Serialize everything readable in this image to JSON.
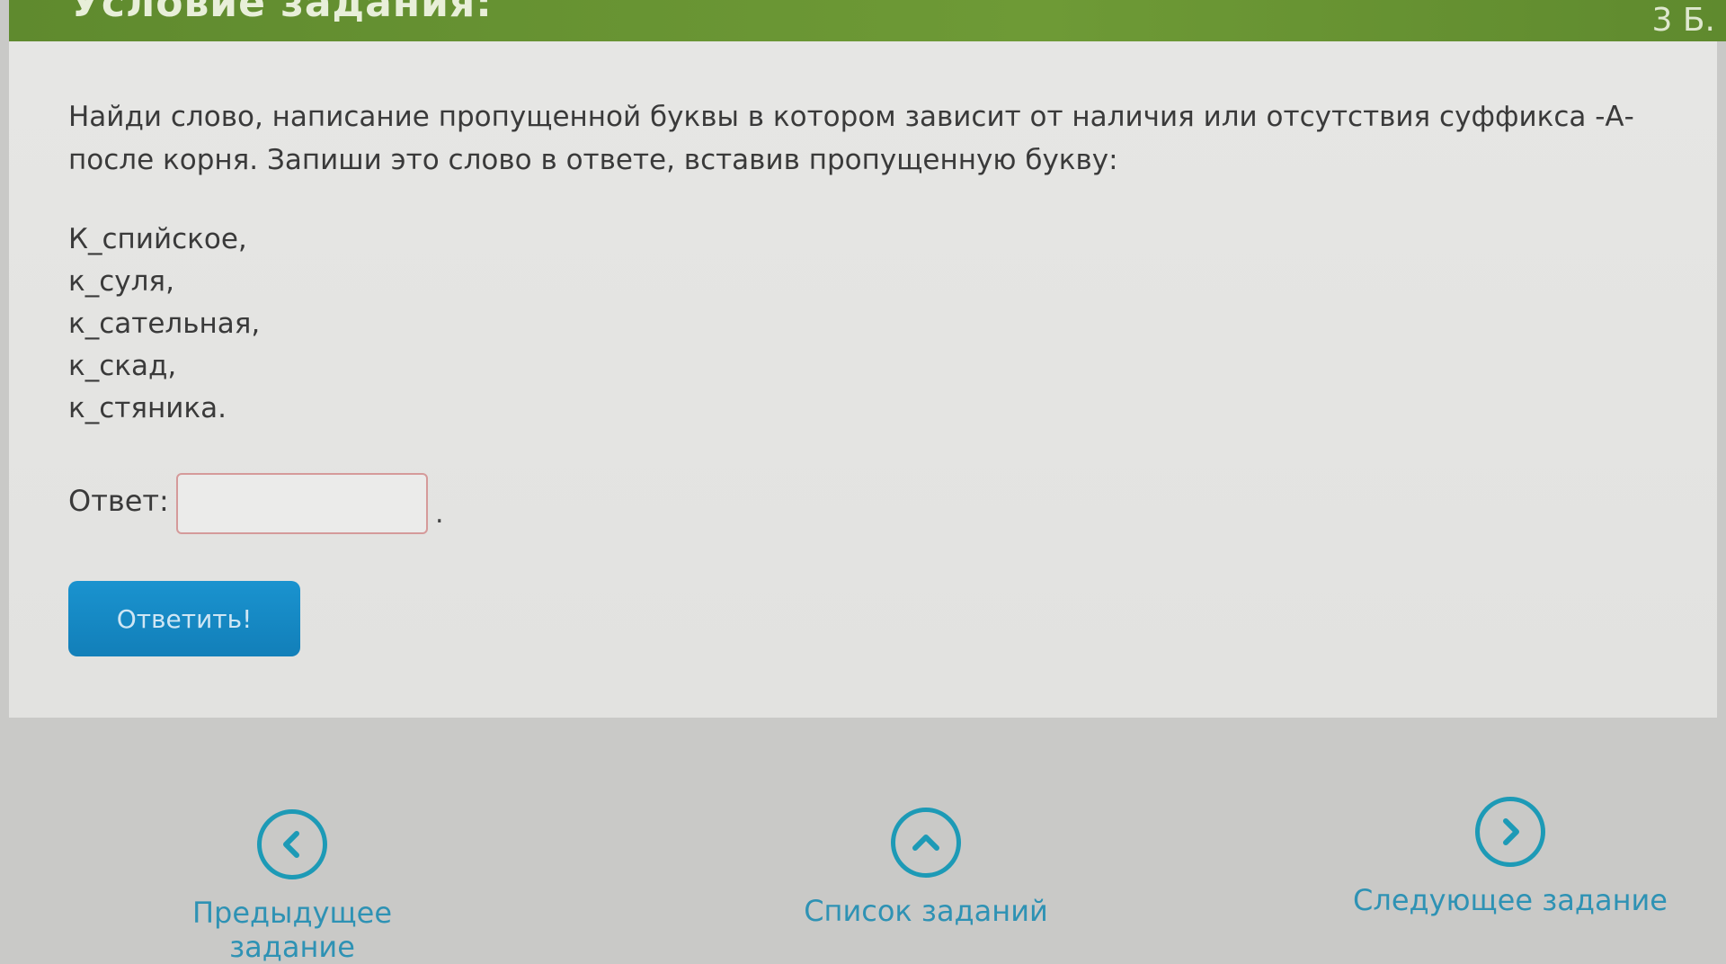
{
  "header": {
    "title": "Условие задания:",
    "points": "3 Б."
  },
  "question": {
    "text": "Найди слово, написание пропущенной буквы в котором зависит от наличия или отсутствия суффикса -А- после корня. Запиши это слово в ответе, вставив пропущенную букву:"
  },
  "words": [
    "К_спийское,",
    "к_суля,",
    "к_сательная,",
    "к_скад,",
    "к_стяника."
  ],
  "answer": {
    "label": "Ответ:",
    "value": "",
    "placeholder": "",
    "suffix": "."
  },
  "submit": {
    "label": "Ответить!"
  },
  "nav": {
    "prev_label": "Предыдущее задание",
    "list_label": "Список заданий",
    "next_label": "Следующее задание"
  },
  "colors": {
    "header": "#6e9a36",
    "button": "#1889c4",
    "nav_accent": "#1d9ab6"
  },
  "icons": [
    "chevron-left-icon",
    "chevron-up-icon",
    "chevron-right-icon"
  ]
}
